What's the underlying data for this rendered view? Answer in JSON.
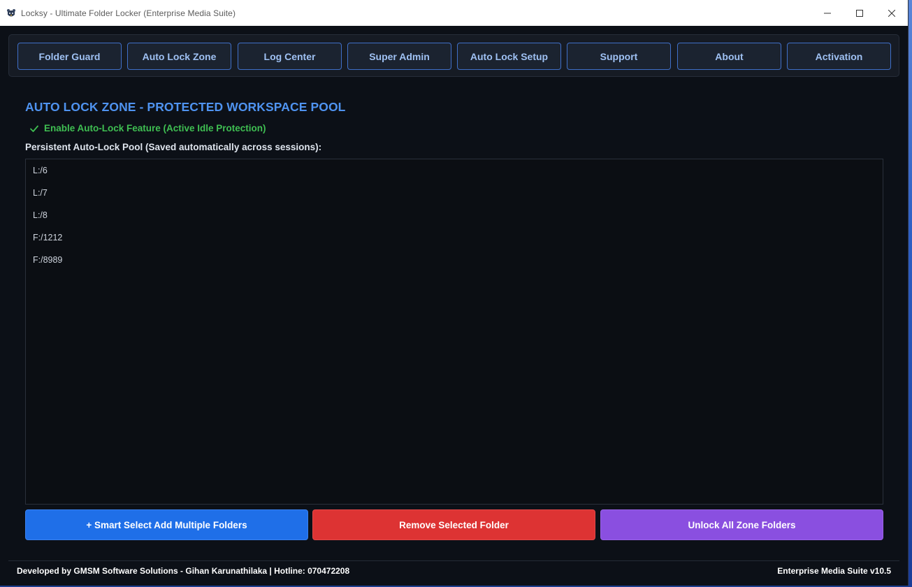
{
  "window": {
    "title": "Locksy - Ultimate Folder Locker (Enterprise Media Suite)",
    "icon": "bear-shield-icon"
  },
  "nav": {
    "items": [
      {
        "label": "Folder Guard"
      },
      {
        "label": "Auto Lock Zone"
      },
      {
        "label": "Log Center"
      },
      {
        "label": "Super Admin"
      },
      {
        "label": "Auto Lock Setup"
      },
      {
        "label": "Support"
      },
      {
        "label": "About"
      },
      {
        "label": "Activation"
      }
    ]
  },
  "main": {
    "section_title": "AUTO LOCK ZONE - PROTECTED WORKSPACE POOL",
    "auto_lock_checkbox": {
      "label": "Enable Auto-Lock Feature (Active Idle Protection)",
      "checked": true
    },
    "pool_label": "Persistent Auto-Lock Pool (Saved automatically across sessions):",
    "pool_items": [
      "L:/6",
      "L:/7",
      "L:/8",
      "F:/1212",
      "F:/8989"
    ],
    "buttons": {
      "add": "+ Smart Select  Add Multiple Folders",
      "remove": "Remove Selected Folder",
      "unlock": "Unlock All Zone Folders"
    }
  },
  "footer": {
    "left": "Developed by GMSM Software Solutions - Gihan Karunathilaka | Hotline: 070472208",
    "right": "Enterprise Media Suite v10.5"
  },
  "colors": {
    "accent_blue": "#4f93f0",
    "check_green": "#3fbf52",
    "add_button": "#1f6fe8",
    "remove_button": "#dd3333",
    "unlock_button": "#8a4fe0"
  }
}
